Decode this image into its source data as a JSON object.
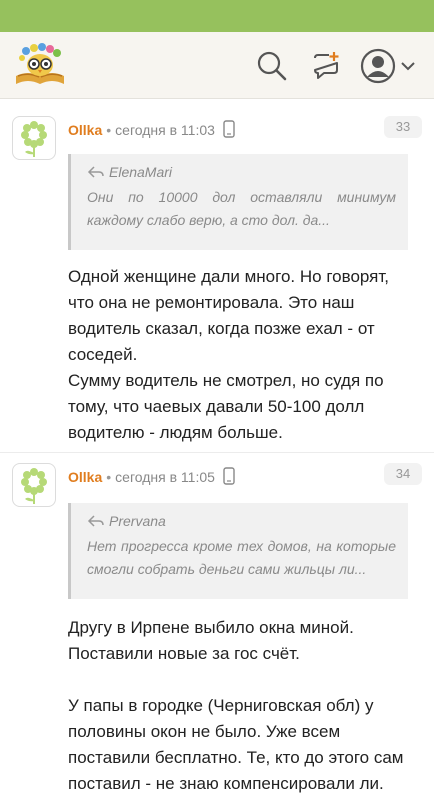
{
  "header": {
    "logo_name": "owl-books-logo",
    "icons": [
      "search-icon",
      "new-post-icon",
      "user-avatar-icon",
      "chevron-down-icon"
    ]
  },
  "posts": [
    {
      "author": "Ollka",
      "time": "сегодня в 11:03",
      "number": "33",
      "quote": {
        "author": "ElenaMari",
        "text": "Они по 10000 дол оставляли минимум каждому слабо верю, а сто дол. да..."
      },
      "body": [
        "Одной женщине дали много. Но говорят, что она не ремонтировала. Это наш водитель сказал, когда позже ехал - от соседей.\nСумму водитель не смотрел, но судя по тому, что чаевых давали 50-100 долл водителю - людям больше."
      ]
    },
    {
      "author": "Ollka",
      "time": "сегодня в 11:05",
      "number": "34",
      "quote": {
        "author": "Prervana",
        "text": "Нет прогресса кроме тех домов, на которые смогли собрать деньги сами жильцы ли..."
      },
      "body": [
        "Другу в Ирпене выбило окна миной. Поставили новые за гос счёт.",
        "У папы в городке (Черниговская обл) у половины окон не было. Уже всем поставили бесплатно. Те, кто до этого сам поставил - не знаю компенсировали ли."
      ]
    }
  ],
  "colors": {
    "topbar": "#96c15d",
    "author": "#e07d1f",
    "header_bg": "#f7f5f0"
  }
}
